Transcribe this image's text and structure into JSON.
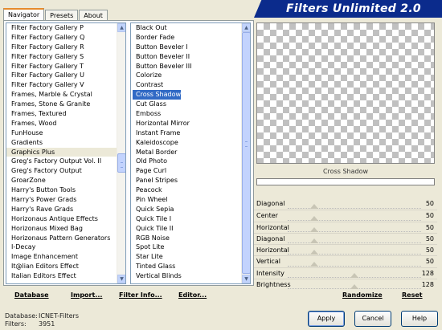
{
  "tabs": [
    "Navigator",
    "Presets",
    "About"
  ],
  "app_title": "Filters Unlimited 2.0",
  "categories": [
    "Filter Factory Gallery P",
    "Filter Factory Gallery Q",
    "Filter Factory Gallery R",
    "Filter Factory Gallery S",
    "Filter Factory Gallery T",
    "Filter Factory Gallery U",
    "Filter Factory Gallery V",
    "Frames, Marble & Crystal",
    "Frames, Stone & Granite",
    "Frames, Textured",
    "Frames, Wood",
    "FunHouse",
    "Gradients",
    "Graphics Plus",
    "Greg's Factory Output Vol. II",
    "Greg's Factory Output",
    "GroarZone",
    "Harry's Button Tools",
    "Harry's Power Grads",
    "Harry's Rave Grads",
    "Horizonaus Antique Effects",
    "Horizonaus Mixed Bag",
    "Horizonaus Pattern Generators",
    "I-Decay",
    "Image Enhancement",
    "It@lian Editors Effect",
    "Italian Editors Effect"
  ],
  "selected_category": "Graphics Plus",
  "filters": [
    "Black Out",
    "Border Fade",
    "Button Beveler I",
    "Button Beveler II",
    "Button Beveler III",
    "Colorize",
    "Contrast",
    "Cross Shadow",
    "Cut Glass",
    "Emboss",
    "Horizontal Mirror",
    "Instant Frame",
    "Kaleidoscope",
    "Metal Border",
    "Old Photo",
    "Page Curl",
    "Panel Stripes",
    "Peacock",
    "Pin Wheel",
    "Quick Sepia",
    "Quick Tile I",
    "Quick Tile II",
    "RGB Noise",
    "Spot Lite",
    "Star Lite",
    "Tinted Glass",
    "Vertical Blinds"
  ],
  "selected_filter": "Cross Shadow",
  "preview_filter_name": "Cross Shadow",
  "sliders": [
    {
      "label": "Diagonal",
      "value": "50",
      "level": 0.2
    },
    {
      "label": "Center",
      "value": "50",
      "level": 0.2
    },
    {
      "label": "Horizontal",
      "value": "50",
      "level": 0.2
    },
    {
      "label": "Diagonal",
      "value": "50",
      "level": 0.2
    },
    {
      "label": "Horizontal",
      "value": "50",
      "level": 0.2
    },
    {
      "label": "Vertical",
      "value": "50",
      "level": 0.2
    },
    {
      "label": "Intensity",
      "value": "128",
      "level": 0.5
    },
    {
      "label": "Brightness",
      "value": "128",
      "level": 0.5
    }
  ],
  "links": {
    "database": "Database",
    "import": "Import...",
    "filter_info": "Filter Info...",
    "editor": "Editor...",
    "randomize": "Randomize",
    "reset": "Reset"
  },
  "info": {
    "database_label": "Database:",
    "database_value": "ICNET-Filters",
    "filters_label": "Filters:",
    "filters_value": "3951"
  },
  "buttons": {
    "apply": "Apply",
    "cancel": "Cancel",
    "help": "Help"
  },
  "colors": {
    "banner": "#0b2b8c",
    "selection": "#316ac5"
  }
}
